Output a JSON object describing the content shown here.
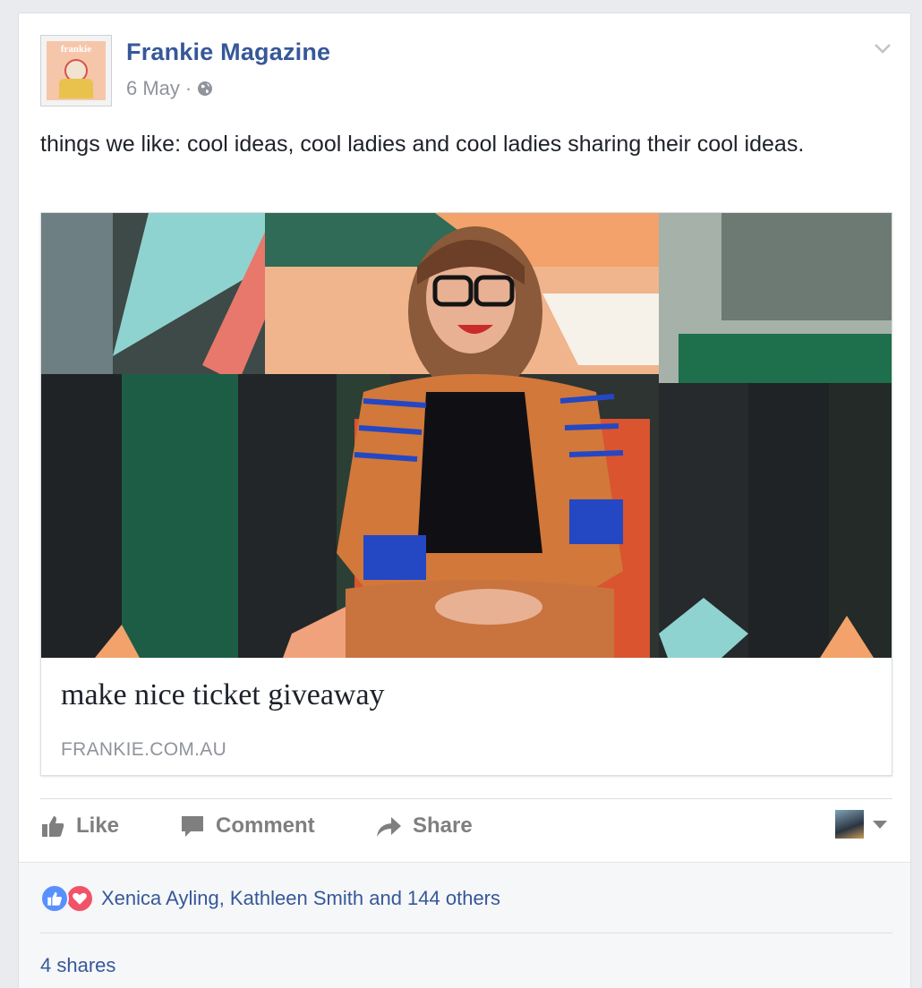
{
  "post": {
    "page_name": "Frankie Magazine",
    "date": "6 May",
    "separator": "·",
    "audience_icon": "globe-icon",
    "text": "things we like: cool ideas, cool ladies and cool ladies sharing their cool ideas.",
    "avatar_word": "frankie"
  },
  "link": {
    "title": "make nice ticket giveaway",
    "domain": "FRANKIE.COM.AU"
  },
  "actions": {
    "like": "Like",
    "comment": "Comment",
    "share": "Share"
  },
  "reactions": {
    "names": "Xenica Ayling, Kathleen Smith and 144 others",
    "types": [
      "like",
      "love"
    ]
  },
  "shares": "4 shares",
  "colors": {
    "link_blue": "#365899",
    "muted_gray": "#90949c",
    "like_blue": "#5890ff",
    "love_red": "#f25268"
  }
}
